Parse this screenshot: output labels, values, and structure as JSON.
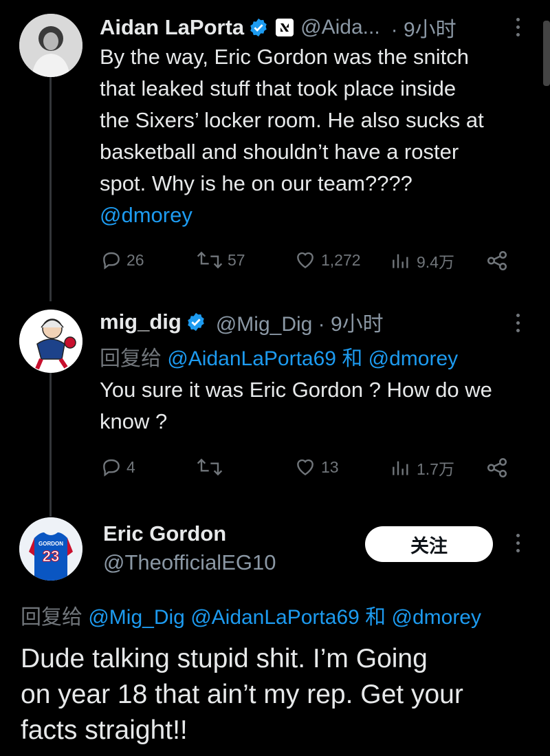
{
  "tweet1": {
    "name": "Aidan LaPorta",
    "handle": "@Aida...",
    "time": "· 9小时",
    "text_lines": [
      "By the way, Eric Gordon was the snitch",
      "that leaked stuff that took place inside",
      "the Sixers’ locker room. He also sucks at",
      "basketball and shouldn’t have a roster",
      "spot. Why is he on our team????"
    ],
    "mention": "@dmorey",
    "replies": "26",
    "retweets": "57",
    "likes": "1,272",
    "views": "9.4万"
  },
  "tweet2": {
    "name": "mig_dig",
    "handle": "@Mig_Dig · 9小时",
    "reply_prefix": "回复给",
    "reply_mention1": "@AidanLaPorta69",
    "reply_and": "和",
    "reply_mention2": "@dmorey",
    "text_lines": [
      "You sure it was Eric Gordon ? How do we",
      "know ?"
    ],
    "replies": "4",
    "retweets": "",
    "likes": "13",
    "views": "1.7万"
  },
  "tweet3": {
    "name": "Eric Gordon",
    "handle": "@TheofficialEG10",
    "follow_label": "关注",
    "reply_prefix": "回复给",
    "reply_mention1": "@Mig_Dig",
    "reply_mention2": "@AidanLaPorta69",
    "reply_and": "和",
    "reply_mention3": "@dmorey",
    "text_lines": [
      "Dude talking stupid shit.  I’m Going",
      "on year 18 that ain’t my rep.  Get your",
      "facts straight!!"
    ],
    "jersey_name": "GORDON",
    "jersey_number": "23"
  },
  "colors": {
    "accent": "#1d9bf0",
    "muted": "#71767b",
    "text": "#e7e9ea",
    "bg": "#000000"
  }
}
